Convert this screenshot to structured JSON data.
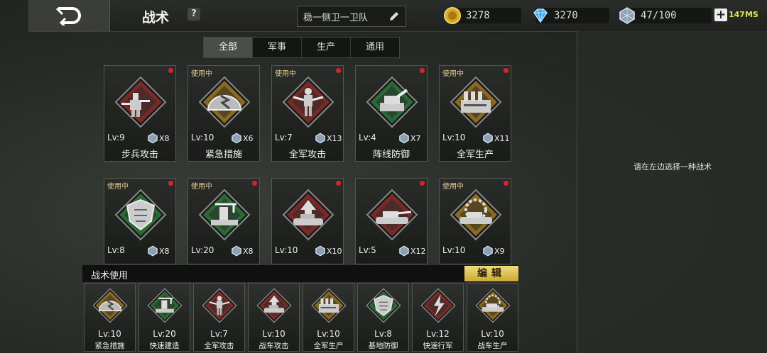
{
  "header": {
    "title": "战术",
    "help_icon": "?",
    "preset_name": "稳一侧卫一卫队",
    "gold": "3278",
    "diamond": "3270",
    "supply": "47/100",
    "plus": "+",
    "ping": "147MS"
  },
  "tabs": [
    {
      "label": "全部",
      "active": true
    },
    {
      "label": "军事"
    },
    {
      "label": "生产"
    },
    {
      "label": "通用"
    }
  ],
  "in_use_label": "使用中",
  "cards": [
    {
      "name": "步兵攻击",
      "lv": "Lv:9",
      "count": "X8",
      "in_use": false,
      "dot": true,
      "frame": "red",
      "icon": "infantry-icon"
    },
    {
      "name": "紧急措施",
      "lv": "Lv:10",
      "count": "X6",
      "in_use": true,
      "dot": false,
      "frame": "gold",
      "icon": "bunker-lightning-icon"
    },
    {
      "name": "全军攻击",
      "lv": "Lv:7",
      "count": "X13",
      "in_use": true,
      "dot": true,
      "frame": "red",
      "icon": "soldier-icon"
    },
    {
      "name": "阵线防御",
      "lv": "Lv:4",
      "count": "X7",
      "in_use": false,
      "dot": true,
      "frame": "green",
      "icon": "turret-icon"
    },
    {
      "name": "全军生产",
      "lv": "Lv:10",
      "count": "X11",
      "in_use": true,
      "dot": true,
      "frame": "gold",
      "icon": "factory-icon"
    },
    {
      "name": "",
      "lv": "Lv:8",
      "count": "X8",
      "in_use": true,
      "dot": true,
      "frame": "green",
      "icon": "shield-emblem-icon"
    },
    {
      "name": "",
      "lv": "Lv:20",
      "count": "X8",
      "in_use": true,
      "dot": true,
      "frame": "green",
      "icon": "construction-icon"
    },
    {
      "name": "",
      "lv": "Lv:10",
      "count": "X10",
      "in_use": false,
      "dot": true,
      "frame": "red",
      "icon": "tank-attack-icon"
    },
    {
      "name": "",
      "lv": "Lv:5",
      "count": "X12",
      "in_use": false,
      "dot": true,
      "frame": "red",
      "icon": "tank-icon"
    },
    {
      "name": "",
      "lv": "Lv:10",
      "count": "X9",
      "in_use": true,
      "dot": true,
      "frame": "gold",
      "icon": "tank-gear-icon"
    }
  ],
  "hint": "请在左边选择一种战术",
  "tactic_use": {
    "title": "战术使用",
    "edit_label": "编辑",
    "slots": [
      {
        "lv": "Lv:10",
        "name": "紧急措施",
        "frame": "gold",
        "icon": "bunker-lightning-icon"
      },
      {
        "lv": "Lv:20",
        "name": "快速建造",
        "frame": "green",
        "icon": "construction-icon"
      },
      {
        "lv": "Lv:7",
        "name": "全军攻击",
        "frame": "red",
        "icon": "soldier-icon"
      },
      {
        "lv": "Lv:10",
        "name": "战车攻击",
        "frame": "red",
        "icon": "tank-attack-icon"
      },
      {
        "lv": "Lv:10",
        "name": "全军生产",
        "frame": "gold",
        "icon": "factory-icon"
      },
      {
        "lv": "Lv:8",
        "name": "基地防御",
        "frame": "green",
        "icon": "shield-emblem-icon"
      },
      {
        "lv": "Lv:12",
        "name": "快速行军",
        "frame": "red",
        "icon": "lightning-icon"
      },
      {
        "lv": "Lv:10",
        "name": "战车生产",
        "frame": "gold",
        "icon": "tank-gear-icon"
      }
    ]
  },
  "colors": {
    "red": "#7a2a26",
    "gold": "#8a6a1e",
    "green": "#2a6a34"
  }
}
